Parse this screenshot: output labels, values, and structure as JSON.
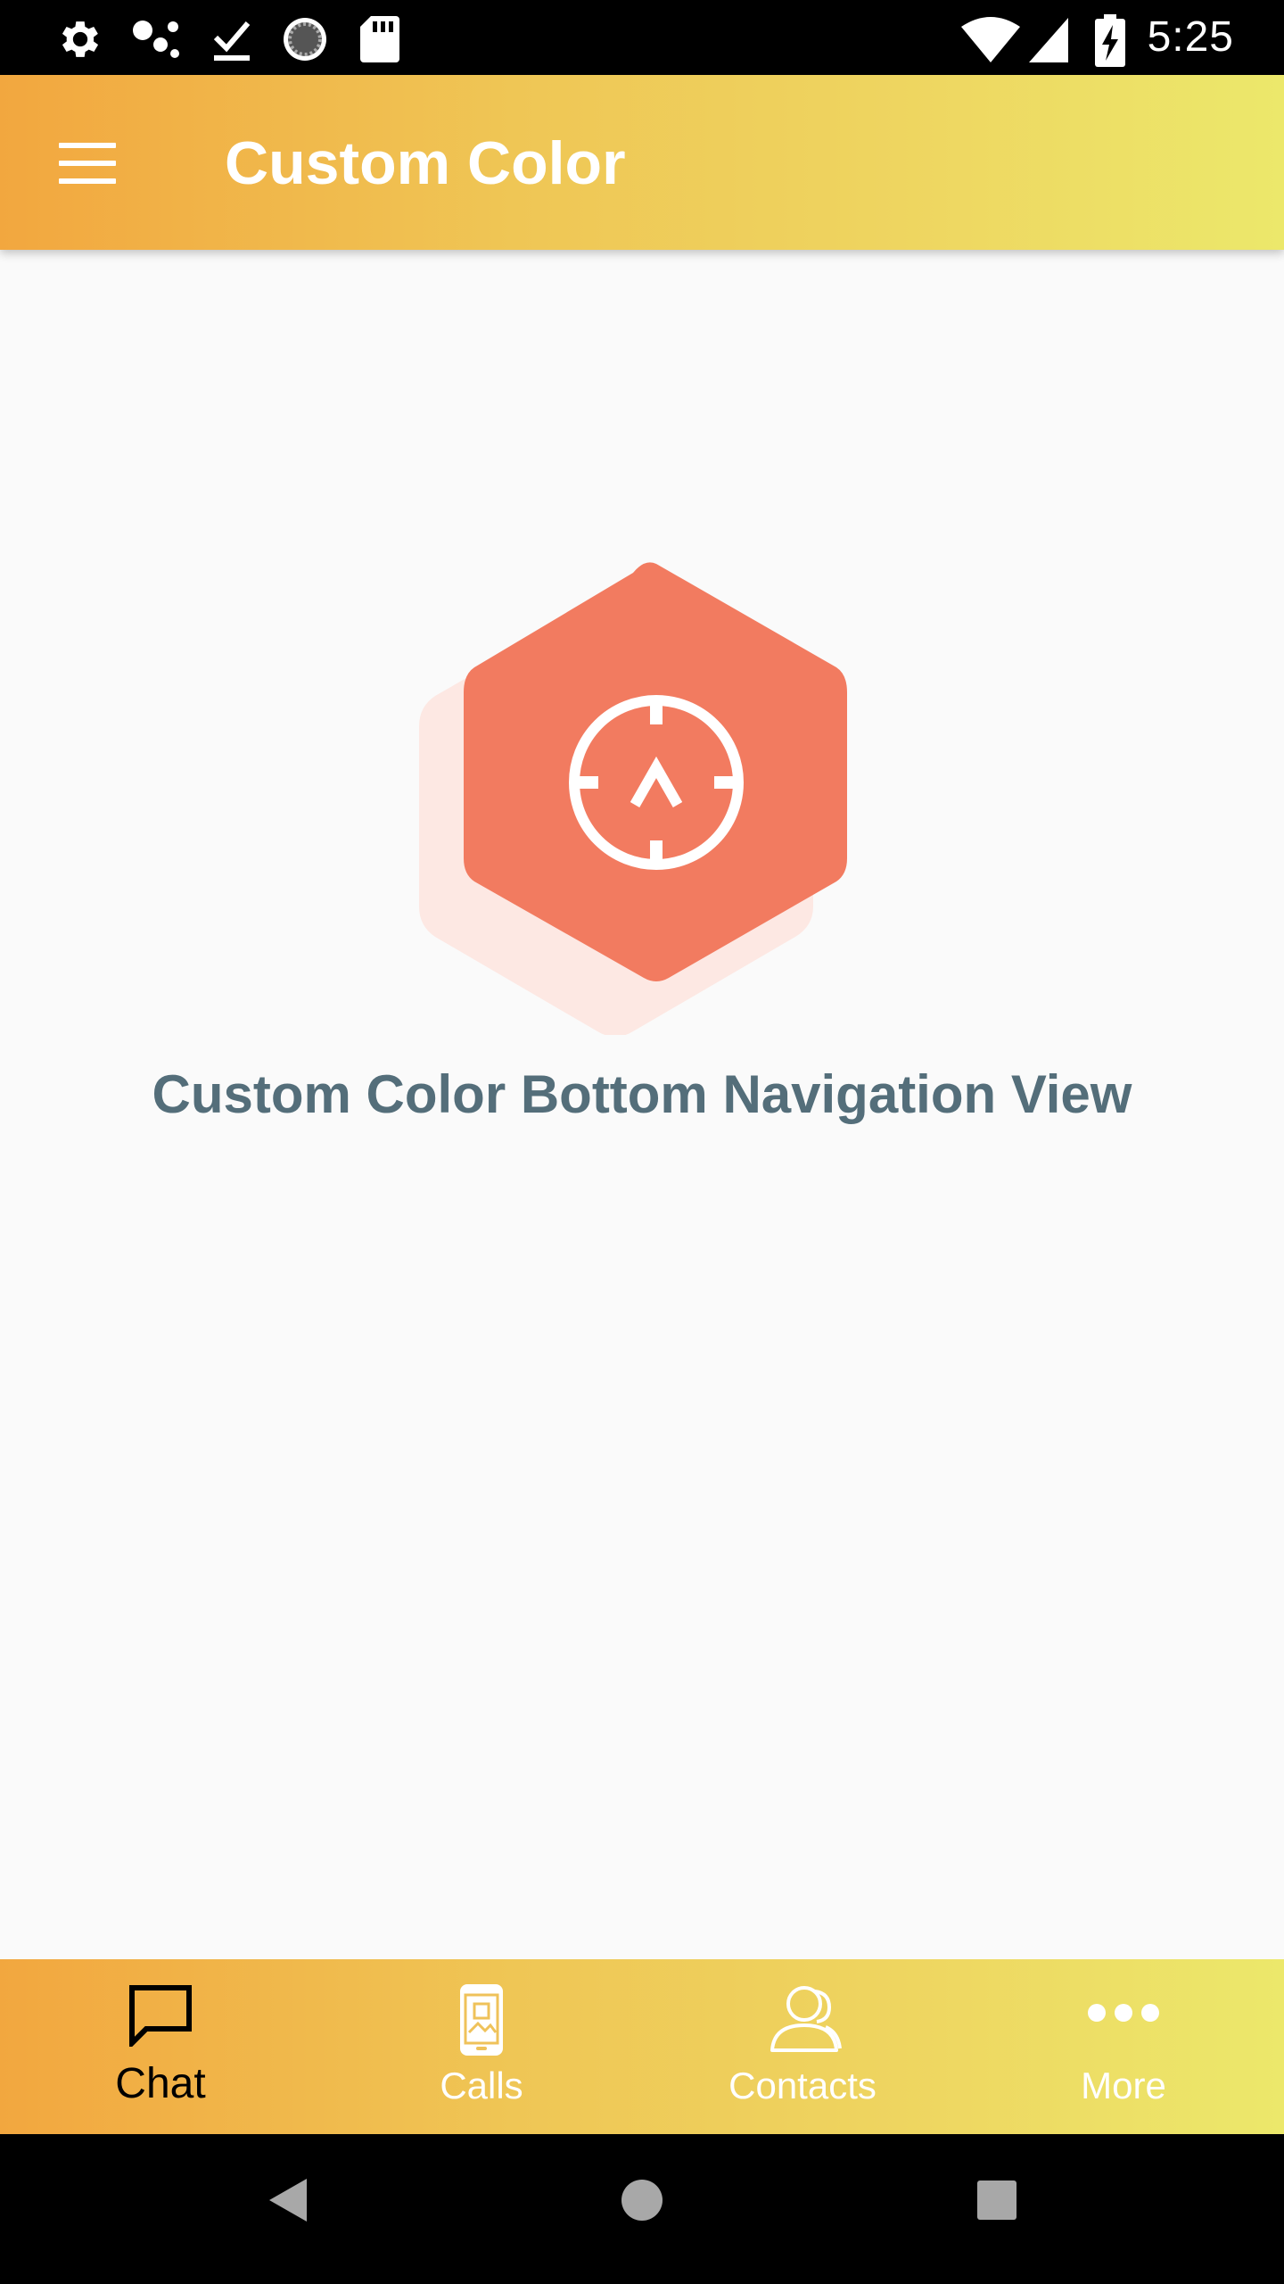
{
  "status_bar": {
    "time": "5:25",
    "left_icons": [
      "gear-icon",
      "dots-icon",
      "download-done-icon",
      "sync-icon",
      "sd-card-icon"
    ],
    "right_icons": [
      "wifi-icon",
      "signal-icon",
      "battery-charging-icon"
    ]
  },
  "app_bar": {
    "title": "Custom Color",
    "menu_icon": "hamburger-menu-icon",
    "gradient": [
      "#f2a73f",
      "#ece86b"
    ]
  },
  "main": {
    "hero_icon": "crosshair-hexagon-icon",
    "hero_color": "#f27b60",
    "message": "Custom Color Bottom Navigation View"
  },
  "bottom_nav": {
    "items": [
      {
        "label": "Chat",
        "icon": "chat-bubble-icon",
        "active": true
      },
      {
        "label": "Calls",
        "icon": "phone-icon",
        "active": false
      },
      {
        "label": "Contacts",
        "icon": "contacts-icon",
        "active": false
      },
      {
        "label": "More",
        "icon": "more-dots-icon",
        "active": false
      }
    ]
  },
  "system_nav": {
    "buttons": [
      "back-icon",
      "home-icon",
      "recents-icon"
    ]
  }
}
